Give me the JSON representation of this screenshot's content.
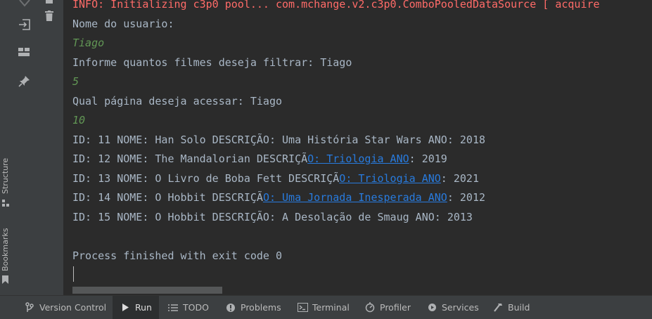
{
  "console": {
    "lines": [
      {
        "text": "INFO: Initializing c3p0 pool... com.mchange.v2.c3p0.ComboPooledDataSource [ acquire"
      },
      {
        "text": "Nome do usuario:"
      },
      {
        "text": "Tiago"
      },
      {
        "text": "Informe quantos filmes deseja filtrar: Tiago"
      },
      {
        "text": "5"
      },
      {
        "text": "Qual página deseja acessar: Tiago"
      },
      {
        "text": "10"
      },
      {
        "text": "ID: 11 NOME: Han Solo DESCRIÇÃO: Uma História Star Wars ANO: 2018"
      },
      {
        "pre": "ID: 12 NOME: The Mandalorian DESCRIÇÃ",
        "link": "O: Triologia ANO",
        "post": ": 2019"
      },
      {
        "pre": "ID: 13 NOME: O Livro de Boba Fett DESCRIÇÃ",
        "link": "O: Triologia ANO",
        "post": ": 2021"
      },
      {
        "pre": "ID: 14 NOME: O Hobbit DESCRIÇÃ",
        "link": "O: Uma Jornada Inesperada ANO",
        "post": ": 2012"
      },
      {
        "text": "ID: 15 NOME: O Hobbit DESCRIÇÃO: A Desolação de Smaug ANO: 2013"
      },
      {
        "text": "Process finished with exit code 0"
      }
    ]
  },
  "left_strip": {
    "structure_label": "Structure",
    "bookmarks_label": "Bookmarks"
  },
  "bottom_bar": {
    "version_control": "Version Control",
    "run": "Run",
    "todo": "TODO",
    "problems": "Problems",
    "terminal": "Terminal",
    "profiler": "Profiler",
    "services": "Services",
    "build": "Build"
  },
  "colors": {
    "console_bg": "#2b2b2b",
    "console_text": "#a9b7c6",
    "error_text": "#ff6b68",
    "input_text": "#629755",
    "link": "#287bde",
    "toolbar_bg": "#3c3f41"
  },
  "icons": {
    "left_actions": [
      "exit-icon",
      "trash-icon",
      "layout-icon",
      "pin-icon"
    ],
    "bottom": [
      "branch-icon",
      "play-icon",
      "list-icon",
      "info-icon",
      "terminal-icon",
      "profiler-icon",
      "services-icon",
      "hammer-icon"
    ]
  }
}
